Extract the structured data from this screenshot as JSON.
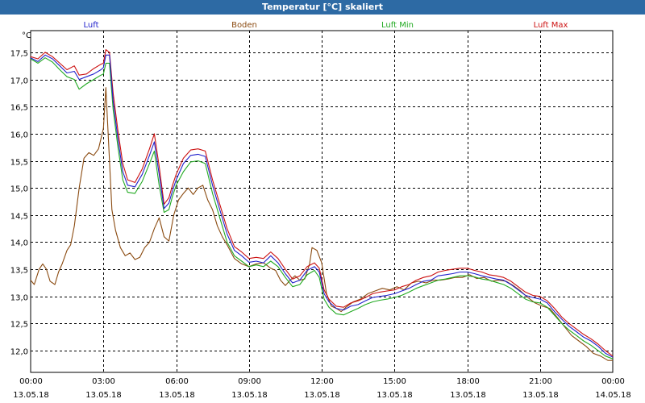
{
  "window": {
    "title": "Temperatur [°C] skaliert"
  },
  "chart_data": {
    "type": "line",
    "title": "Temperatur [°C] skaliert",
    "ylabel": "°C",
    "xlim": [
      0,
      24
    ],
    "ylim": [
      11.6,
      17.9
    ],
    "grid": true,
    "legend_placement": "top",
    "x_ticks": [
      {
        "x": 0,
        "time": "00:00",
        "date": "13.05.18"
      },
      {
        "x": 3,
        "time": "03:00",
        "date": "13.05.18"
      },
      {
        "x": 6,
        "time": "06:00",
        "date": "13.05.18"
      },
      {
        "x": 9,
        "time": "09:00",
        "date": "13.05.18"
      },
      {
        "x": 12,
        "time": "12:00",
        "date": "13.05.18"
      },
      {
        "x": 15,
        "time": "15:00",
        "date": "13.05.18"
      },
      {
        "x": 18,
        "time": "18:00",
        "date": "13.05.18"
      },
      {
        "x": 21,
        "time": "21:00",
        "date": "13.05.18"
      },
      {
        "x": 24,
        "time": "00:00",
        "date": "14.05.18"
      }
    ],
    "y_ticks": [
      {
        "v": 12.0,
        "label": "12,0"
      },
      {
        "v": 12.5,
        "label": "12,5"
      },
      {
        "v": 13.0,
        "label": "13,0"
      },
      {
        "v": 13.5,
        "label": "13,5"
      },
      {
        "v": 14.0,
        "label": "14,0"
      },
      {
        "v": 14.5,
        "label": "14,5"
      },
      {
        "v": 15.0,
        "label": "15,0"
      },
      {
        "v": 15.5,
        "label": "15,5"
      },
      {
        "v": 16.0,
        "label": "16,0"
      },
      {
        "v": 16.5,
        "label": "16,5"
      },
      {
        "v": 17.0,
        "label": "17,0"
      },
      {
        "v": 17.5,
        "label": "17,5"
      }
    ],
    "series": [
      {
        "name": "Luft",
        "color": "#2222cc",
        "x": [
          0,
          0.3,
          0.6,
          0.9,
          1.2,
          1.5,
          1.8,
          2.0,
          2.3,
          2.6,
          2.9,
          3.0,
          3.1,
          3.25,
          3.4,
          3.6,
          3.8,
          4.0,
          4.3,
          4.6,
          4.9,
          5.1,
          5.3,
          5.5,
          5.7,
          5.85,
          6.0,
          6.3,
          6.6,
          6.9,
          7.2,
          7.5,
          7.8,
          8.1,
          8.4,
          8.7,
          9.0,
          9.3,
          9.6,
          9.9,
          10.2,
          10.5,
          10.8,
          11.1,
          11.4,
          11.7,
          11.9,
          12.1,
          12.3,
          12.6,
          12.9,
          13.2,
          13.5,
          13.8,
          14.1,
          14.4,
          14.7,
          15.0,
          15.3,
          15.6,
          15.9,
          16.2,
          16.5,
          16.8,
          17.1,
          17.4,
          17.7,
          18.0,
          18.3,
          18.6,
          18.9,
          19.2,
          19.5,
          19.8,
          20.1,
          20.4,
          20.7,
          21.0,
          21.3,
          21.6,
          21.9,
          22.2,
          22.5,
          22.8,
          23.1,
          23.4,
          23.7,
          24.0
        ],
        "values": [
          17.4,
          17.33,
          17.45,
          17.38,
          17.25,
          17.12,
          17.15,
          17.0,
          17.05,
          17.1,
          17.18,
          17.22,
          17.45,
          17.45,
          16.6,
          15.9,
          15.3,
          15.05,
          15.02,
          15.25,
          15.6,
          15.85,
          15.25,
          14.62,
          14.72,
          14.95,
          15.15,
          15.45,
          15.6,
          15.62,
          15.58,
          15.05,
          14.6,
          14.15,
          13.85,
          13.75,
          13.63,
          13.65,
          13.62,
          13.75,
          13.62,
          13.42,
          13.25,
          13.3,
          13.48,
          13.55,
          13.45,
          13.05,
          12.9,
          12.78,
          12.75,
          12.82,
          12.85,
          12.92,
          12.98,
          13.0,
          13.02,
          13.05,
          13.1,
          13.15,
          13.22,
          13.28,
          13.3,
          13.38,
          13.4,
          13.42,
          13.45,
          13.45,
          13.42,
          13.38,
          13.35,
          13.32,
          13.3,
          13.22,
          13.12,
          13.02,
          12.98,
          12.95,
          12.88,
          12.72,
          12.58,
          12.45,
          12.35,
          12.25,
          12.18,
          12.08,
          11.95,
          11.88
        ]
      },
      {
        "name": "Boden",
        "color": "#8a4a10",
        "x": [
          0,
          0.15,
          0.35,
          0.5,
          0.65,
          0.8,
          1.0,
          1.15,
          1.3,
          1.5,
          1.65,
          1.8,
          2.0,
          2.2,
          2.4,
          2.6,
          2.8,
          3.0,
          3.1,
          3.25,
          3.35,
          3.5,
          3.7,
          3.9,
          4.1,
          4.3,
          4.5,
          4.7,
          4.9,
          5.1,
          5.3,
          5.5,
          5.7,
          5.9,
          6.1,
          6.3,
          6.5,
          6.7,
          6.9,
          7.1,
          7.3,
          7.5,
          7.7,
          7.9,
          8.1,
          8.4,
          8.7,
          9.0,
          9.3,
          9.6,
          9.9,
          10.1,
          10.3,
          10.5,
          10.7,
          10.9,
          11.1,
          11.3,
          11.5,
          11.6,
          11.8,
          12.0,
          12.2,
          12.4,
          12.6,
          12.8,
          13.0,
          13.3,
          13.6,
          13.9,
          14.2,
          14.5,
          14.8,
          15.1,
          15.4,
          15.7,
          16.0,
          16.3,
          16.6,
          16.9,
          17.2,
          17.5,
          17.8,
          18.1,
          18.4,
          18.7,
          19.0,
          19.3,
          19.6,
          19.9,
          20.2,
          20.5,
          20.8,
          21.1,
          21.4,
          21.7,
          22.0,
          22.3,
          22.6,
          22.9,
          23.2,
          23.5,
          23.8,
          24.0
        ],
        "values": [
          13.3,
          13.22,
          13.5,
          13.6,
          13.5,
          13.28,
          13.22,
          13.45,
          13.6,
          13.85,
          13.95,
          14.3,
          15.0,
          15.55,
          15.65,
          15.6,
          15.72,
          16.1,
          16.85,
          15.5,
          14.6,
          14.22,
          13.9,
          13.75,
          13.8,
          13.68,
          13.72,
          13.9,
          14.0,
          14.25,
          14.45,
          14.1,
          14.02,
          14.5,
          14.78,
          14.9,
          15.0,
          14.88,
          15.0,
          15.05,
          14.78,
          14.6,
          14.3,
          14.1,
          13.95,
          13.7,
          13.6,
          13.55,
          13.6,
          13.62,
          13.52,
          13.48,
          13.3,
          13.2,
          13.3,
          13.38,
          13.3,
          13.32,
          13.6,
          13.9,
          13.85,
          13.62,
          13.05,
          12.82,
          12.78,
          12.72,
          12.8,
          12.9,
          12.95,
          13.05,
          13.1,
          13.15,
          13.12,
          13.18,
          13.12,
          13.25,
          13.28,
          13.25,
          13.3,
          13.3,
          13.32,
          13.35,
          13.35,
          13.4,
          13.33,
          13.35,
          13.28,
          13.3,
          13.28,
          13.2,
          13.1,
          12.98,
          12.88,
          12.82,
          12.78,
          12.62,
          12.45,
          12.28,
          12.18,
          12.08,
          11.95,
          11.9,
          11.82,
          11.82
        ]
      },
      {
        "name": "Luft Min",
        "color": "#22aa22",
        "x": [
          0,
          0.3,
          0.6,
          0.9,
          1.2,
          1.5,
          1.8,
          2.0,
          2.3,
          2.6,
          2.9,
          3.0,
          3.1,
          3.25,
          3.4,
          3.6,
          3.8,
          4.0,
          4.3,
          4.6,
          4.9,
          5.1,
          5.3,
          5.5,
          5.7,
          5.85,
          6.0,
          6.3,
          6.6,
          6.9,
          7.2,
          7.5,
          7.8,
          8.1,
          8.4,
          8.7,
          9.0,
          9.3,
          9.6,
          9.9,
          10.2,
          10.5,
          10.8,
          11.1,
          11.4,
          11.7,
          11.9,
          12.1,
          12.3,
          12.6,
          12.9,
          13.2,
          13.5,
          13.8,
          14.1,
          14.4,
          14.7,
          15.0,
          15.3,
          15.6,
          15.9,
          16.2,
          16.5,
          16.8,
          17.1,
          17.4,
          17.7,
          18.0,
          18.3,
          18.6,
          18.9,
          19.2,
          19.5,
          19.8,
          20.1,
          20.4,
          20.7,
          21.0,
          21.3,
          21.6,
          21.9,
          22.2,
          22.5,
          22.8,
          23.1,
          23.4,
          23.7,
          24.0
        ],
        "values": [
          17.38,
          17.3,
          17.4,
          17.32,
          17.18,
          17.05,
          17.0,
          16.82,
          16.92,
          17.0,
          17.08,
          17.1,
          17.3,
          17.3,
          16.45,
          15.75,
          15.15,
          14.92,
          14.9,
          15.12,
          15.45,
          15.68,
          15.05,
          14.55,
          14.6,
          14.85,
          15.05,
          15.3,
          15.48,
          15.5,
          15.45,
          14.9,
          14.45,
          14.0,
          13.75,
          13.65,
          13.55,
          13.58,
          13.55,
          13.65,
          13.55,
          13.35,
          13.18,
          13.22,
          13.4,
          13.48,
          13.35,
          12.95,
          12.8,
          12.68,
          12.66,
          12.72,
          12.78,
          12.85,
          12.9,
          12.93,
          12.95,
          12.98,
          13.02,
          13.08,
          13.15,
          13.2,
          13.25,
          13.3,
          13.32,
          13.35,
          13.38,
          13.38,
          13.36,
          13.32,
          13.3,
          13.26,
          13.22,
          13.15,
          13.05,
          12.95,
          12.9,
          12.88,
          12.8,
          12.65,
          12.5,
          12.38,
          12.28,
          12.18,
          12.1,
          12.0,
          11.9,
          11.85
        ]
      },
      {
        "name": "Luft Max",
        "color": "#cc1111",
        "x": [
          0,
          0.3,
          0.6,
          0.9,
          1.2,
          1.5,
          1.8,
          2.0,
          2.3,
          2.6,
          2.9,
          3.0,
          3.1,
          3.25,
          3.4,
          3.6,
          3.8,
          4.0,
          4.3,
          4.6,
          4.9,
          5.1,
          5.3,
          5.5,
          5.7,
          5.85,
          6.0,
          6.3,
          6.6,
          6.9,
          7.2,
          7.5,
          7.8,
          8.1,
          8.4,
          8.7,
          9.0,
          9.3,
          9.6,
          9.9,
          10.2,
          10.5,
          10.8,
          11.1,
          11.4,
          11.7,
          11.9,
          12.1,
          12.3,
          12.6,
          12.9,
          13.2,
          13.5,
          13.8,
          14.1,
          14.4,
          14.7,
          15.0,
          15.3,
          15.6,
          15.9,
          16.2,
          16.5,
          16.8,
          17.1,
          17.4,
          17.7,
          18.0,
          18.3,
          18.6,
          18.9,
          19.2,
          19.5,
          19.8,
          20.1,
          20.4,
          20.7,
          21.0,
          21.3,
          21.6,
          21.9,
          22.2,
          22.5,
          22.8,
          23.1,
          23.4,
          23.7,
          24.0
        ],
        "values": [
          17.42,
          17.38,
          17.5,
          17.42,
          17.3,
          17.18,
          17.25,
          17.08,
          17.1,
          17.2,
          17.28,
          17.3,
          17.55,
          17.5,
          16.75,
          16.05,
          15.45,
          15.15,
          15.1,
          15.35,
          15.72,
          16.0,
          15.4,
          14.7,
          14.82,
          15.05,
          15.25,
          15.55,
          15.7,
          15.72,
          15.68,
          15.15,
          14.7,
          14.25,
          13.92,
          13.82,
          13.7,
          13.72,
          13.7,
          13.82,
          13.7,
          13.5,
          13.32,
          13.38,
          13.55,
          13.62,
          13.52,
          13.12,
          12.95,
          12.82,
          12.8,
          12.88,
          12.92,
          12.98,
          13.05,
          13.08,
          13.1,
          13.12,
          13.18,
          13.22,
          13.3,
          13.35,
          13.38,
          13.45,
          13.48,
          13.5,
          13.52,
          13.52,
          13.48,
          13.45,
          13.4,
          13.38,
          13.35,
          13.28,
          13.18,
          13.08,
          13.02,
          13.0,
          12.92,
          12.78,
          12.62,
          12.5,
          12.4,
          12.3,
          12.22,
          12.12,
          12.0,
          11.9
        ]
      }
    ]
  }
}
